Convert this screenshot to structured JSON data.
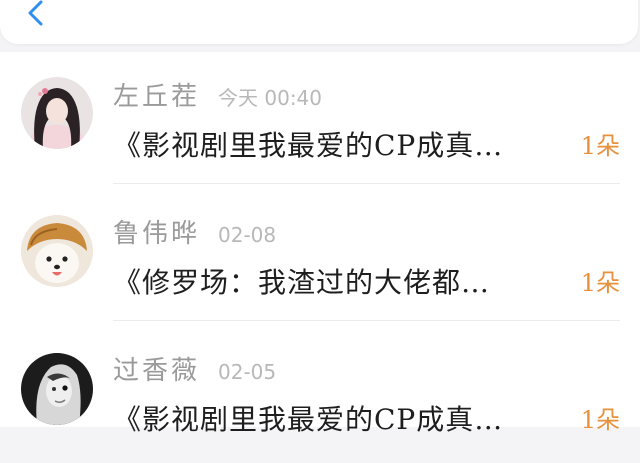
{
  "colors": {
    "accent": "#2f8ff0",
    "count": "#e8913c",
    "name": "#9a9a9a",
    "time": "#b8b8b8",
    "title": "#1e1e1e"
  },
  "header": {
    "back_icon": "chevron-left-icon"
  },
  "items": [
    {
      "name": "左丘茬",
      "time": "今天 00:40",
      "title": "《影视剧里我最爱的CP成真…",
      "count": "1朵"
    },
    {
      "name": "鲁伟晔",
      "time": "02-08",
      "title": "《修罗场：我渣过的大佬都…",
      "count": "1朵"
    },
    {
      "name": "过香薇",
      "time": "02-05",
      "title": "《影视剧里我最爱的CP成真…",
      "count": "1朵"
    }
  ]
}
